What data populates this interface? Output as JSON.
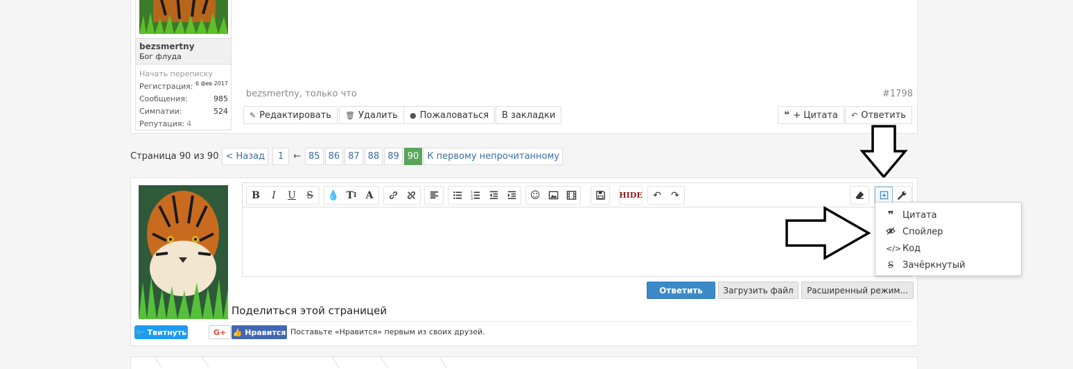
{
  "post": {
    "username": "bezsmertny",
    "user_title": "Бог флуда",
    "start_conversation": "Начать переписку",
    "stats": [
      {
        "label": "Регистрация:",
        "value": "6 фев 2017"
      },
      {
        "label": "Сообщения:",
        "value": "985"
      },
      {
        "label": "Симпатии:",
        "value": "524"
      },
      {
        "label": "Репутация:",
        "value": "4"
      }
    ],
    "meta": "bezsmertny, только что",
    "number": "#1798",
    "actions": {
      "edit": "Редактировать",
      "delete": "Удалить",
      "report": "Пожаловаться",
      "bookmark": "В закладки",
      "quote": "+ Цитата",
      "reply": "Ответить"
    }
  },
  "pagenav": {
    "label": "Страница 90 из 90",
    "prev": "< Назад",
    "first": "1",
    "ellipsis": "←",
    "pages": [
      "85",
      "86",
      "87",
      "88",
      "89"
    ],
    "current": "90",
    "unread": "К первому непрочитанному"
  },
  "editor": {
    "toolbar_icons": [
      "bold-icon",
      "italic-icon",
      "underline-icon",
      "strike-icon",
      "color-icon",
      "font-size-icon",
      "font-family-icon",
      "link-icon",
      "unlink-icon",
      "align-icon",
      "bullet-list-icon",
      "number-list-icon",
      "outdent-icon",
      "indent-icon",
      "smilie-icon",
      "image-icon",
      "media-icon",
      "draft-icon",
      "hide-icon",
      "undo-icon",
      "redo-icon",
      "eraser-icon",
      "insert-icon",
      "settings-icon"
    ],
    "hide_label": "HIDE",
    "dropdown": [
      {
        "icon": "quote-icon",
        "label": "Цитата"
      },
      {
        "icon": "spoiler-icon",
        "label": "Спойлер"
      },
      {
        "icon": "code-icon",
        "label": "Код"
      },
      {
        "icon": "strikethrough-icon",
        "label": "Зачёркнутый"
      }
    ],
    "reply_button": "Ответить",
    "upload_button": "Загрузить файл",
    "advanced_button": "Расширенный режим..."
  },
  "share": {
    "title": "Поделиться этой страницей",
    "tweet": "Твитнуть",
    "gplus": "G+",
    "like": "Нравится",
    "like_text": "Поставьте «Нравится» первым из своих друзей."
  },
  "colors": {
    "accent": "#3b8ac7",
    "current_page": "#5ba55b",
    "twitter": "#1d9bf0",
    "facebook": "#4267b2"
  }
}
